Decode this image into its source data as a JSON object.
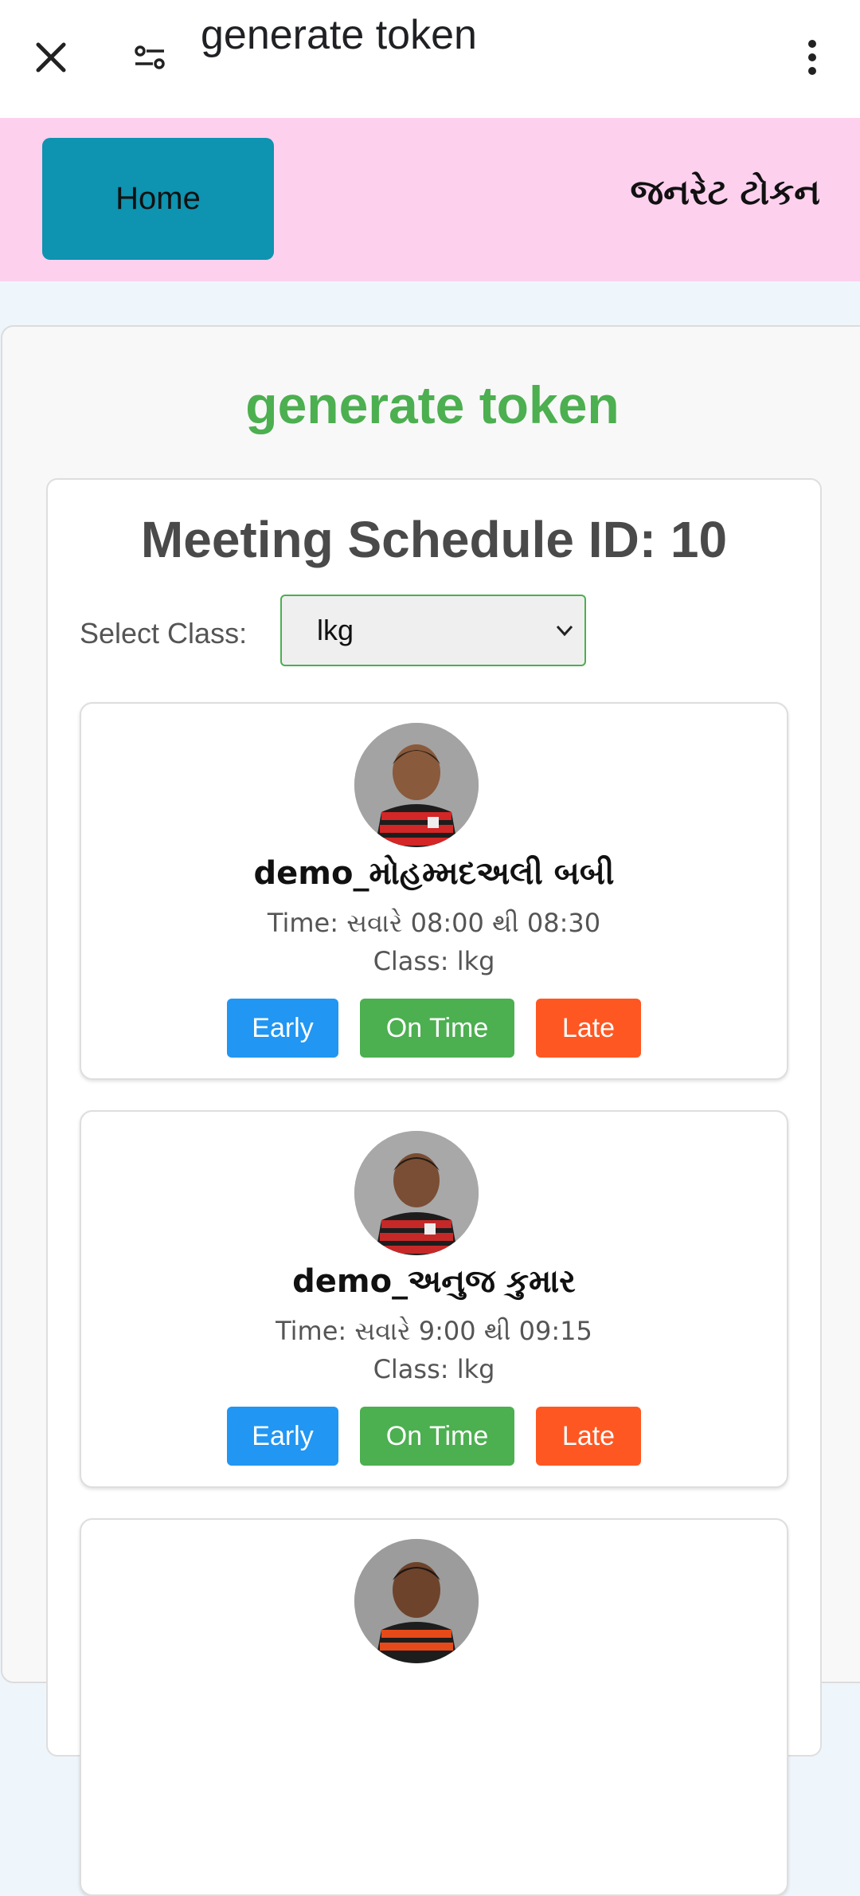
{
  "browser": {
    "title": "generate token",
    "close_icon": "close-icon",
    "tune_icon": "tune-icon",
    "more_icon": "more-vert-icon"
  },
  "header": {
    "home_label": "Home",
    "page_title_gu": "જનરેટ ટોકન"
  },
  "main": {
    "title": "generate token",
    "schedule_title": "Meeting Schedule ID: 10",
    "select_label": "Select Class:",
    "select_value": "lkg"
  },
  "students": [
    {
      "name": "demo_મોહમ્મદઅલી બબી",
      "time": "Time: સવારે 08:00 થી 08:30",
      "class": "Class: lkg",
      "early": "Early",
      "on_time": "On Time",
      "late": "Late"
    },
    {
      "name": "demo_અનુજ કુમાર",
      "time": "Time: સવારે 9:00 થી 09:15",
      "class": "Class: lkg",
      "early": "Early",
      "on_time": "On Time",
      "late": "Late"
    },
    {
      "name": "",
      "time": "",
      "class": "",
      "early": "",
      "on_time": "",
      "late": ""
    }
  ],
  "colors": {
    "header_pink": "#fdd0ee",
    "home_button": "#0e93b0",
    "title_green": "#4caf50",
    "early_blue": "#2196f3",
    "ontime_green": "#4caf50",
    "late_orange": "#ff5722"
  }
}
